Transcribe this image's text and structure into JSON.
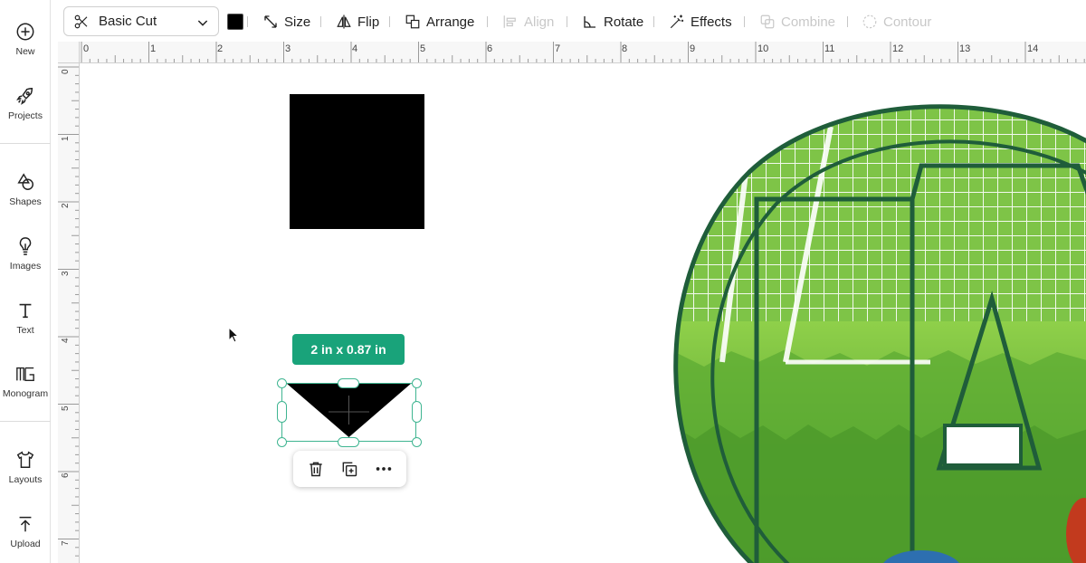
{
  "sidebar": {
    "items": [
      {
        "label": "New",
        "icon": "plus-circle-icon"
      },
      {
        "label": "Projects",
        "icon": "rocket-icon"
      },
      {
        "label": "Shapes",
        "icon": "shapes-icon"
      },
      {
        "label": "Images",
        "icon": "lightbulb-icon"
      },
      {
        "label": "Text",
        "icon": "text-icon"
      },
      {
        "label": "Monogram",
        "icon": "monogram-icon"
      },
      {
        "label": "Layouts",
        "icon": "shirt-icon"
      },
      {
        "label": "Upload",
        "icon": "upload-icon"
      }
    ]
  },
  "toolbar": {
    "operation": "Basic Cut",
    "operation_icon": "scissors-icon",
    "color": "#000000",
    "size_label": "Size",
    "flip_label": "Flip",
    "arrange_label": "Arrange",
    "align_label": "Align",
    "rotate_label": "Rotate",
    "effects_label": "Effects",
    "combine_label": "Combine",
    "contour_label": "Contour"
  },
  "rulers": {
    "top": [
      "0",
      "1",
      "2",
      "3",
      "4",
      "5",
      "6",
      "7",
      "8",
      "9",
      "10",
      "11",
      "12",
      "13",
      "14"
    ],
    "left": [
      "0",
      "1",
      "2",
      "3",
      "4",
      "5",
      "6",
      "7"
    ]
  },
  "canvas": {
    "dimension_badge": "2  in x 0.87  in",
    "mini_toolbar": [
      "trash-icon",
      "duplicate-icon",
      "more-icon"
    ],
    "accent_color": "#19a37a"
  }
}
